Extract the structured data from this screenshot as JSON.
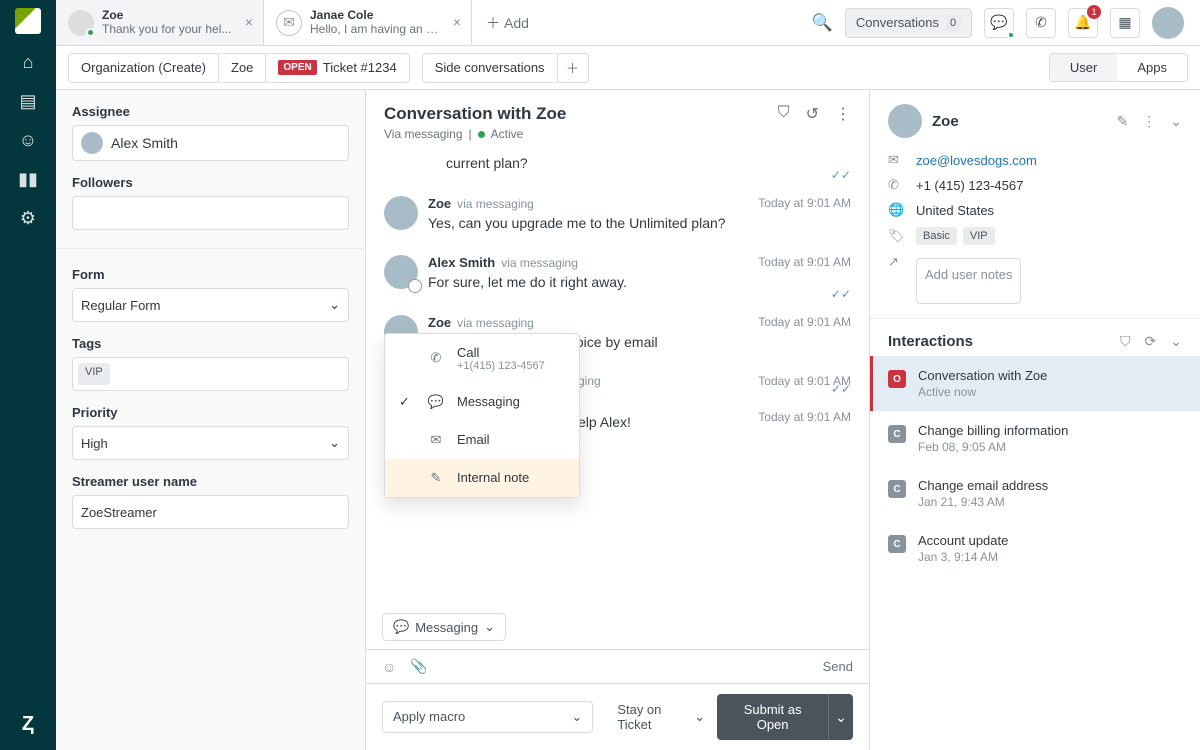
{
  "tabs": [
    {
      "title": "Zoe",
      "subtitle": "Thank you for your hel...",
      "active": true,
      "icon": "avatar"
    },
    {
      "title": "Janae Cole",
      "subtitle": "Hello, I am having an is...",
      "active": false,
      "icon": "envelope"
    }
  ],
  "addTab": "Add",
  "topbar": {
    "conversations": "Conversations",
    "convCount": "0",
    "notifCount": "1"
  },
  "breadcrumb": {
    "org": "Organization (Create)",
    "user": "Zoe",
    "status": "OPEN",
    "ticket": "Ticket #1234",
    "side": "Side conversations"
  },
  "toggle": {
    "user": "User",
    "apps": "Apps"
  },
  "leftPanel": {
    "assigneeLabel": "Assignee",
    "assignee": "Alex Smith",
    "followersLabel": "Followers",
    "formLabel": "Form",
    "form": "Regular Form",
    "tagsLabel": "Tags",
    "tags": [
      "VIP"
    ],
    "priorityLabel": "Priority",
    "priority": "High",
    "streamerLabel": "Streamer user name",
    "streamer": "ZoeStreamer"
  },
  "conversation": {
    "title": "Conversation with Zoe",
    "via": "Via messaging",
    "status": "Active",
    "messages": [
      {
        "author": "",
        "via": "",
        "text": "current plan?",
        "time": "",
        "checks": true,
        "avatar": false
      },
      {
        "author": "Zoe",
        "via": "via messaging",
        "text": "Yes, can you upgrade me to the Unlimited plan?",
        "time": "Today at 9:01 AM",
        "checks": false,
        "avatar": true
      },
      {
        "author": "Alex Smith",
        "via": "via messaging",
        "text": "For sure, let me do it right away.",
        "time": "Today at 9:01 AM",
        "checks": true,
        "avatar": true,
        "agent": true
      },
      {
        "author": "Zoe",
        "via": "via messaging",
        "text": "invoice by email",
        "time": "Today at 9:01 AM",
        "checks": false,
        "avatar": true,
        "truncated": true
      },
      {
        "author": "",
        "via": "ging",
        "text": "",
        "time": "Today at 9:01 AM",
        "checks": true,
        "avatar": false,
        "truncated": true
      },
      {
        "author": "",
        "via": "",
        "text": "elp Alex!",
        "time": "Today at 9:01 AM",
        "checks": false,
        "avatar": false,
        "truncated": true
      }
    ],
    "channelPicker": "Messaging",
    "send": "Send",
    "applyMacro": "Apply macro",
    "stay": "Stay on Ticket",
    "submit": "Submit as Open"
  },
  "channelMenu": [
    {
      "label": "Call",
      "sub": "+1(415) 123-4567",
      "icon": "phone"
    },
    {
      "label": "Messaging",
      "icon": "chat",
      "checked": true
    },
    {
      "label": "Email",
      "icon": "mail"
    },
    {
      "label": "Internal note",
      "icon": "note",
      "highlight": true
    }
  ],
  "userPanel": {
    "name": "Zoe",
    "email": "zoe@lovesdogs.com",
    "phone": "+1 (415) 123-4567",
    "location": "United States",
    "tags": [
      "Basic",
      "VIP"
    ],
    "notesPlaceholder": "Add user notes"
  },
  "interactions": {
    "title": "Interactions",
    "items": [
      {
        "badge": "O",
        "title": "Conversation with Zoe",
        "sub": "Active now",
        "active": true
      },
      {
        "badge": "C",
        "title": "Change billing information",
        "sub": "Feb 08, 9:05 AM"
      },
      {
        "badge": "C",
        "title": "Change email address",
        "sub": "Jan 21, 9:43 AM"
      },
      {
        "badge": "C",
        "title": "Account update",
        "sub": "Jan 3, 9:14 AM"
      }
    ]
  }
}
